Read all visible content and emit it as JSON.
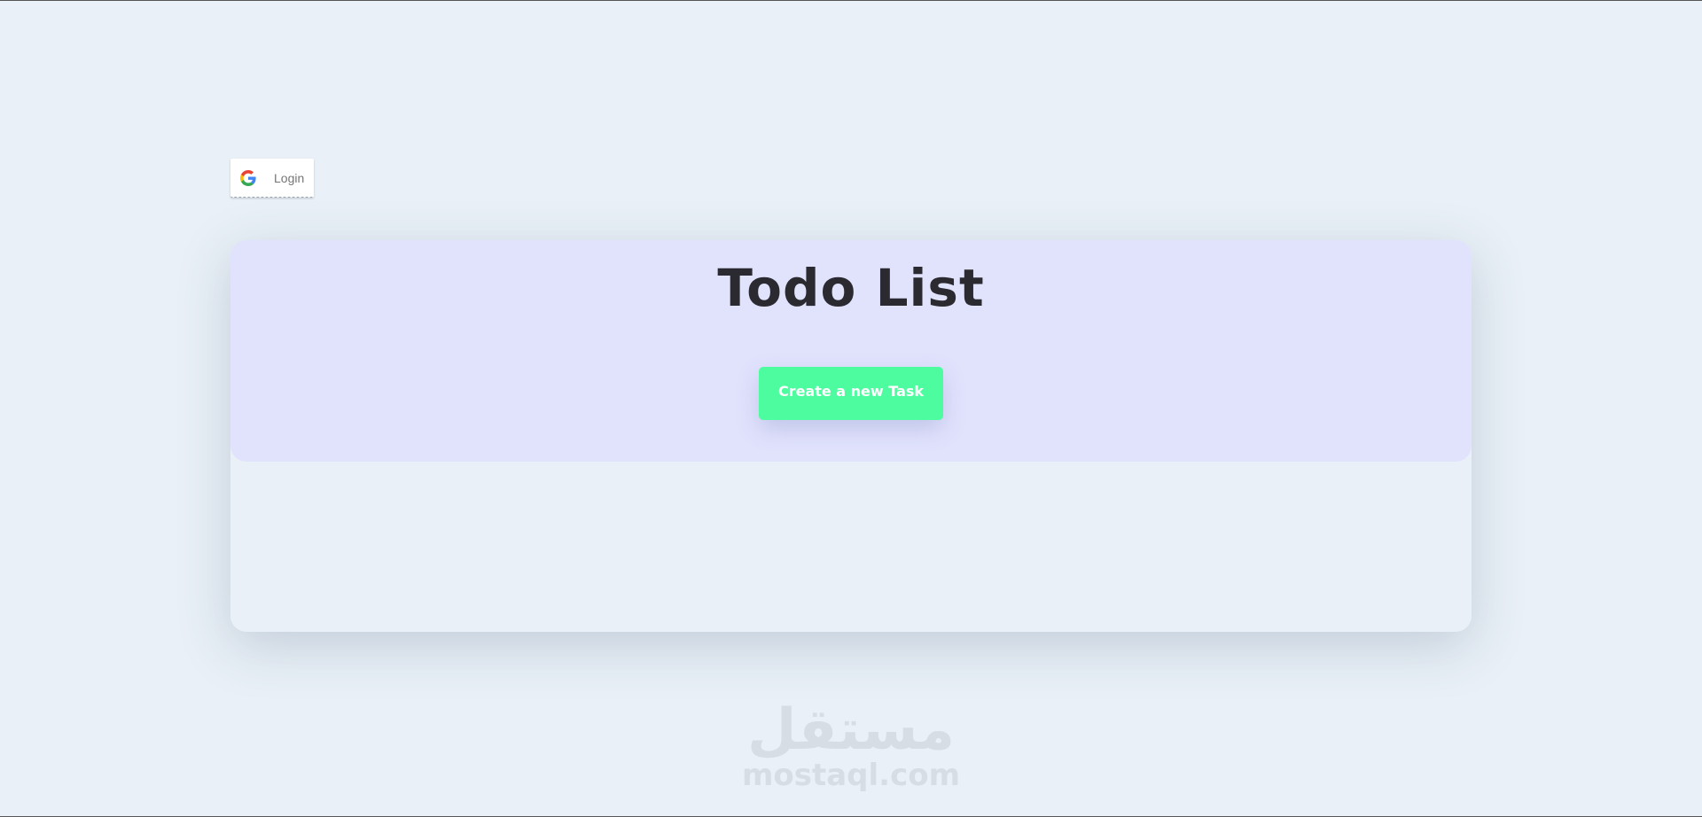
{
  "login": {
    "label": "Login",
    "icon": "google-icon"
  },
  "todo": {
    "title": "Todo List",
    "create_button_label": "Create a new Task"
  },
  "watermark": {
    "arabic_text": "مستقل",
    "latin_text": "mostaql.com"
  },
  "colors": {
    "background": "#e9f0f7",
    "card_header": "#e1e3fd",
    "create_button": "#4dfc9f",
    "title_text": "#2a2a30"
  }
}
